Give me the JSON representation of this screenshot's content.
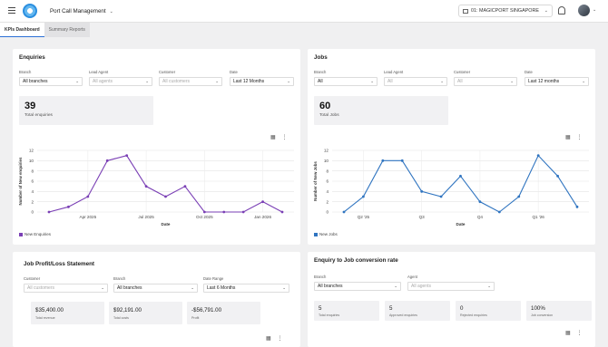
{
  "header": {
    "app_name": "Port Call Management",
    "port_name": "01: MAGICPORT SINGAPORE"
  },
  "tabs": [
    {
      "label": "KPIs Dashboard"
    },
    {
      "label": "Summary Reports"
    }
  ],
  "enquiries": {
    "title": "Enquiries",
    "filters": {
      "branch": {
        "label": "Branch",
        "value": "All branches"
      },
      "lead_agent": {
        "label": "Lead Agent",
        "placeholder": "All agents"
      },
      "customer": {
        "label": "Customer",
        "placeholder": "All customers"
      },
      "date": {
        "label": "Date",
        "value": "Last 12 Months"
      }
    },
    "kpi": {
      "value": "39",
      "label": "Total enquiries"
    },
    "chart_data": {
      "type": "line",
      "x": [
        "Feb 2025",
        "Mar 2025",
        "Apr 2025",
        "May 2025",
        "Jun 2025",
        "Jul 2025",
        "Aug 2025",
        "Sep 2025",
        "Oct 2025",
        "Nov 2025",
        "Dec 2025",
        "Jan 2026",
        "Feb 2026"
      ],
      "x_tick_labels": [
        "Apr 2025",
        "Jul 2025",
        "Oct 2025",
        "Jan 2026"
      ],
      "series": [
        {
          "name": "New Enquiries",
          "values": [
            0,
            1,
            3,
            10,
            11,
            5,
            3,
            5,
            0,
            0,
            0,
            2,
            0
          ],
          "color": "#7a3fb5"
        }
      ],
      "xlabel": "Date",
      "ylabel": "Number of New enquiries",
      "ylim": [
        0,
        12
      ],
      "yticks": [
        "0",
        "2",
        "4",
        "6",
        "8",
        "10",
        "12"
      ],
      "grid": true,
      "legend": "bottom-left"
    }
  },
  "jobs": {
    "title": "Jobs",
    "filters": {
      "branch": {
        "label": "Branch",
        "value": "All"
      },
      "lead_agent": {
        "label": "Lead Agent",
        "placeholder": "All"
      },
      "customer": {
        "label": "Customer",
        "placeholder": "All"
      },
      "date": {
        "label": "Date",
        "value": "Last 12 months"
      }
    },
    "kpi": {
      "value": "60",
      "label": "Total Jobs"
    },
    "chart_data": {
      "type": "line",
      "x": [
        "Feb 2025",
        "Mar 2025",
        "Apr 2025",
        "May 2025",
        "Jun 2025",
        "Jul 2025",
        "Aug 2025",
        "Sep 2025",
        "Oct 2025",
        "Nov 2025",
        "Dec 2025",
        "Jan 2026",
        "Feb 2026"
      ],
      "x_tick_labels": [
        "Q2 '25",
        "Q3",
        "Q4",
        "Q1 '26"
      ],
      "series": [
        {
          "name": "New Jobs",
          "values": [
            0,
            3,
            10,
            10,
            4,
            3,
            7,
            2,
            0,
            3,
            11,
            7,
            1
          ],
          "color": "#2f74c0"
        }
      ],
      "xlabel": "Date",
      "ylabel": "Number of New Jobs",
      "ylim": [
        0,
        12
      ],
      "yticks": [
        "0",
        "2",
        "4",
        "6",
        "8",
        "10",
        "12"
      ],
      "grid": true,
      "legend": "bottom-left"
    }
  },
  "profit_loss": {
    "title": "Job Profit/Loss Statement",
    "filters": {
      "customer": {
        "label": "Customer",
        "placeholder": "All customers"
      },
      "branch": {
        "label": "Branch",
        "value": "All branches"
      },
      "date_range": {
        "label": "Date Range",
        "value": "Last 6 Months"
      }
    },
    "kpis": [
      {
        "value": "$35,400.00",
        "label": "Total revenue"
      },
      {
        "value": "$92,191.00",
        "label": "Total costs"
      },
      {
        "value": "-$56,791.00",
        "label": "Profit"
      }
    ]
  },
  "conversion": {
    "title": "Enquiry to Job conversion rate",
    "filters": {
      "branch": {
        "label": "Branch",
        "value": "All branches"
      },
      "agent": {
        "label": "Agent",
        "placeholder": "All agents"
      }
    },
    "kpis": [
      {
        "value": "5",
        "label": "Total enquiries"
      },
      {
        "value": "5",
        "label": "Approved enquiries"
      },
      {
        "value": "0",
        "label": "Rejected enquiries"
      },
      {
        "value": "100%",
        "label": "Job conversion"
      }
    ]
  },
  "icons": {
    "menu": "hamburger-icon",
    "chart_table": "table-icon",
    "chart_menu": "kebab-menu-icon",
    "notifications": "bell-icon"
  }
}
